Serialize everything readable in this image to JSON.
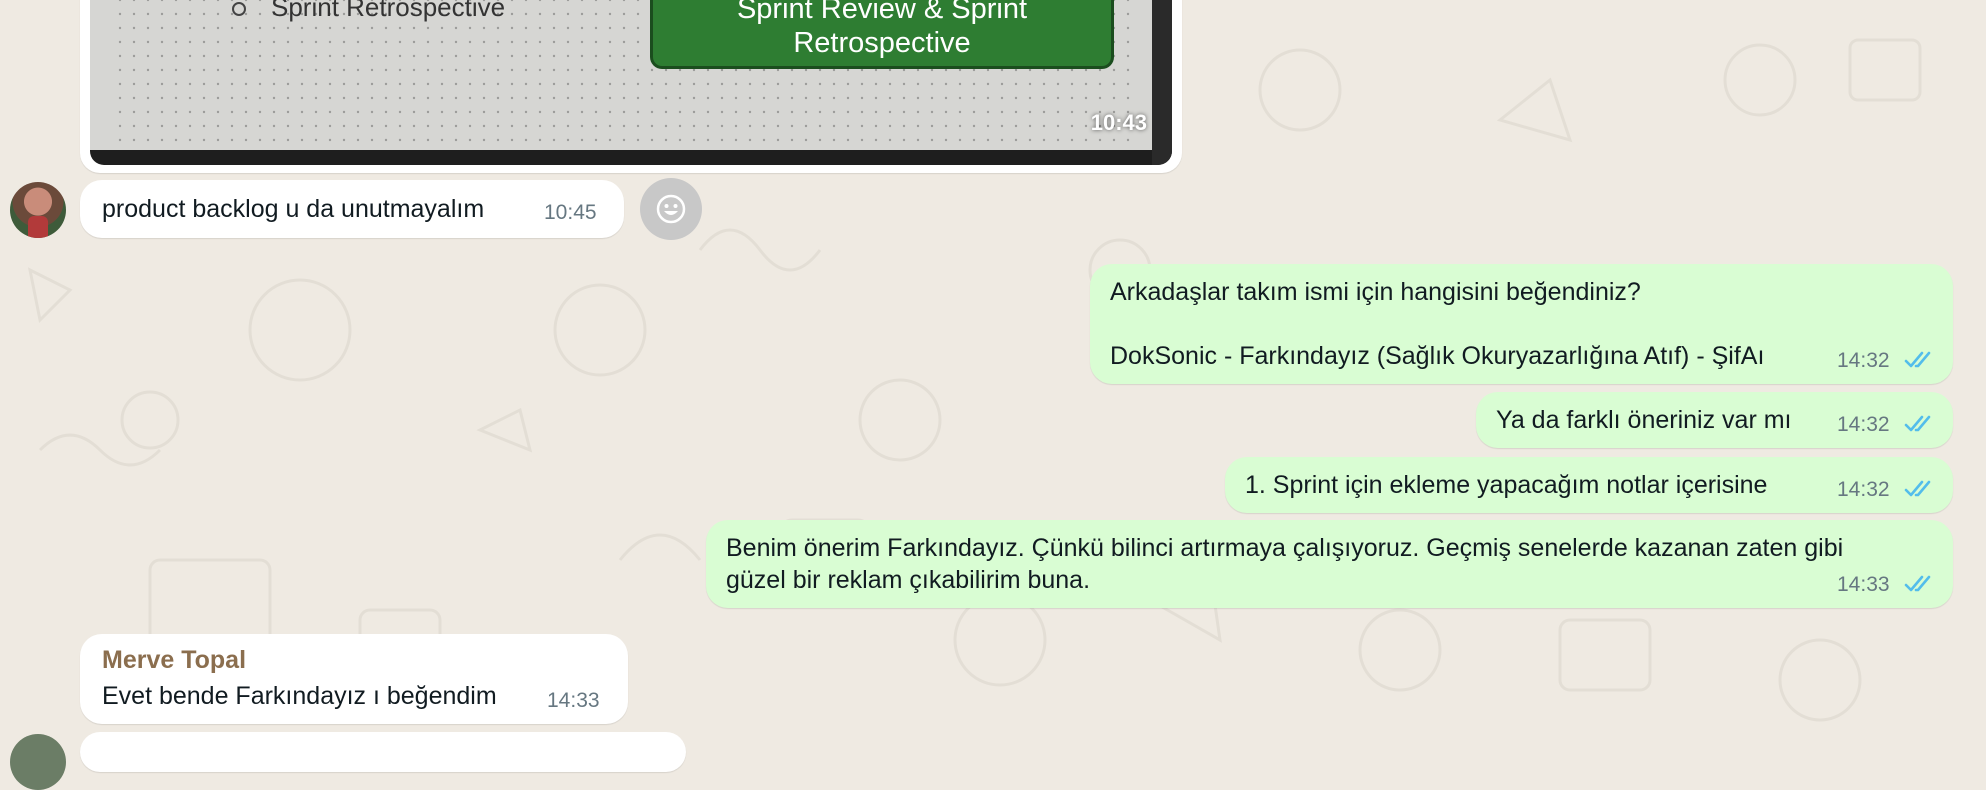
{
  "colors": {
    "background": "#efeae2",
    "incoming_bubble": "#ffffff",
    "outgoing_bubble": "#d9fdd3",
    "read_ticks": "#53bdeb",
    "sender_name": "#8b6e4e",
    "slide_button": "#2e7d32"
  },
  "image_message": {
    "slide_list_item": "Sprint Retrospective",
    "slide_button_line1": "Sprint Review & Sprint",
    "slide_button_line2": "Retrospective",
    "time": "10:43"
  },
  "messages": [
    {
      "direction": "in",
      "text": "product backlog u da unutmayalım",
      "time": "10:45"
    },
    {
      "direction": "out",
      "line1": "Arkadaşlar takım ismi için hangisini beğendiniz?",
      "line2": "DokSonic - Farkındayız (Sağlık Okuryazarlığına Atıf) - ŞifAı",
      "time": "14:32",
      "status_icon": "double-check-icon"
    },
    {
      "direction": "out",
      "text": "Ya da farklı öneriniz var mı",
      "time": "14:32",
      "status_icon": "double-check-icon"
    },
    {
      "direction": "out",
      "text": "1. Sprint için ekleme yapacağım notlar içerisine",
      "time": "14:32",
      "status_icon": "double-check-icon"
    },
    {
      "direction": "out",
      "line1": "Benim önerim Farkındayız. Çünkü bilinci artırmaya çalışıyoruz. Geçmiş senelerde kazanan zaten gibi",
      "line2": "güzel bir reklam çıkabilirim buna.",
      "time": "14:33",
      "status_icon": "double-check-icon"
    },
    {
      "direction": "in",
      "sender": "Merve Topal",
      "text": "Evet bende Farkındayız ı beğendim",
      "time": "14:33"
    }
  ]
}
